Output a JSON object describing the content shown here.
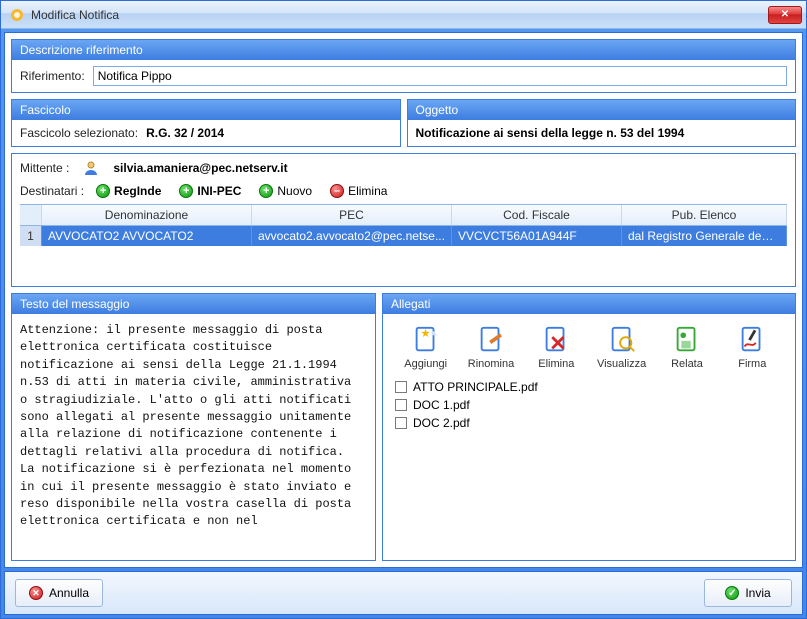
{
  "window": {
    "title": "Modifica Notifica"
  },
  "reference": {
    "panel_title": "Descrizione riferimento",
    "label": "Riferimento:",
    "value": "Notifica Pippo"
  },
  "fascicolo": {
    "panel_title": "Fascicolo",
    "label": "Fascicolo selezionato:",
    "value": "R.G. 32 / 2014"
  },
  "oggetto": {
    "panel_title": "Oggetto",
    "value": "Notificazione ai sensi della legge n. 53 del 1994"
  },
  "sender": {
    "label": "Mittente :",
    "email": "silvia.amaniera@pec.netserv.it"
  },
  "recipients": {
    "label": "Destinatari :",
    "buttons": {
      "reginde": "RegInde",
      "inipec": "INI-PEC",
      "nuovo": "Nuovo",
      "elimina": "Elimina"
    },
    "columns": {
      "denominazione": "Denominazione",
      "pec": "PEC",
      "codfisc": "Cod. Fiscale",
      "pubelenco": "Pub. Elenco"
    },
    "rows": [
      {
        "n": "1",
        "denominazione": "AVVOCATO2 AVVOCATO2",
        "pec": "avvocato2.avvocato2@pec.netse...",
        "codfisc": "VVCVCT56A01A944F",
        "pubelenco": "dal Registro Generale degli Indiriz..."
      }
    ]
  },
  "message": {
    "panel_title": "Testo del messaggio",
    "body": "Attenzione: il presente messaggio di posta elettronica certificata costituisce notificazione ai sensi della Legge 21.1.1994 n.53 di atti in materia civile, amministrativa o stragiudiziale. L'atto o gli atti notificati sono allegati al presente messaggio unitamente alla relazione di notificazione contenente i dettagli relativi alla procedura di notifica. La notificazione si è perfezionata nel momento in cui il presente messaggio è stato inviato e reso disponibile nella vostra casella di posta elettronica certificata e non nel"
  },
  "attachments": {
    "panel_title": "Allegati",
    "buttons": {
      "aggiungi": "Aggiungi",
      "rinomina": "Rinomina",
      "elimina": "Elimina",
      "visualizza": "Visualizza",
      "relata": "Relata",
      "firma": "Firma"
    },
    "items": [
      {
        "name": "ATTO PRINCIPALE.pdf"
      },
      {
        "name": "DOC 1.pdf"
      },
      {
        "name": "DOC 2.pdf"
      }
    ]
  },
  "footer": {
    "cancel": "Annulla",
    "send": "Invia"
  }
}
